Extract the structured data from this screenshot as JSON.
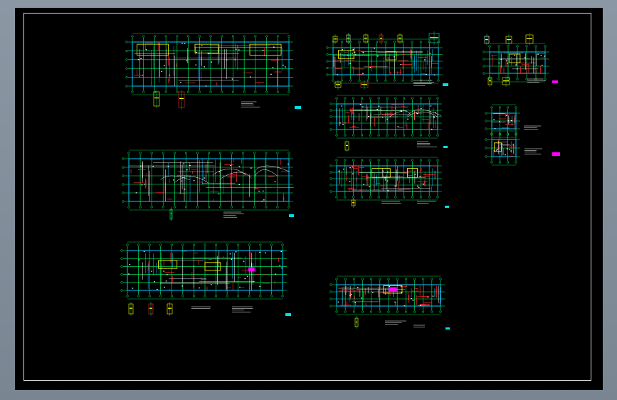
{
  "sheet": {
    "group_titles": [
      "",
      "",
      ""
    ]
  },
  "colors": {
    "background": "#000000",
    "grid": "#00ff66",
    "wall": "#00c8ff",
    "pipe_red": "#ff2a2a",
    "pipe_white": "#ffffff",
    "accent_yellow": "#ffff00",
    "accent_magenta": "#ff00ff",
    "accent_cyan": "#00e0e0"
  },
  "icons": {
    "plan_marker": "cyan-rect",
    "note_marker": "magenta-rect"
  }
}
